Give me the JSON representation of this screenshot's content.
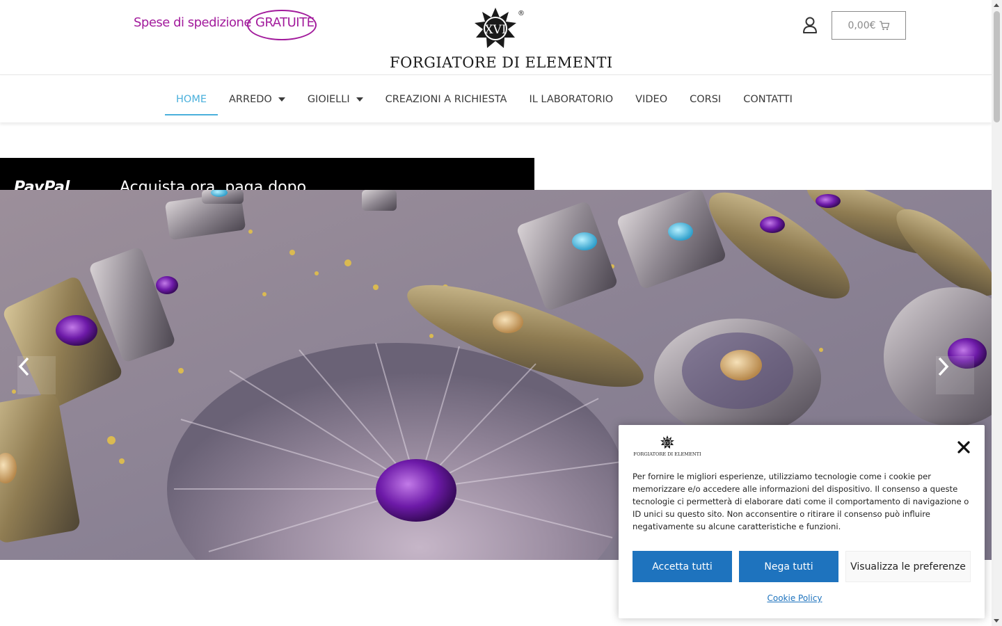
{
  "header": {
    "shipping_text": "Spese di spedizione",
    "shipping_free": "GRATUITE",
    "logo_badge": "XVI",
    "logo_registered": "®",
    "logo_brand": "FORGIATORE DI ELEMENTI",
    "user_icon": "user-icon",
    "cart_total": "0,00€",
    "cart_icon": "cart-icon"
  },
  "nav": {
    "items": [
      {
        "label": "HOME",
        "active": true
      },
      {
        "label": "ARREDO",
        "dropdown": true
      },
      {
        "label": "GIOIELLI",
        "dropdown": true
      },
      {
        "label": "CREAZIONI A RICHIESTA"
      },
      {
        "label": "IL LABORATORIO"
      },
      {
        "label": "VIDEO"
      },
      {
        "label": "CORSI"
      },
      {
        "label": "CONTATTI"
      }
    ],
    "active_color": "#4ab0dc"
  },
  "paypal_banner": {
    "logo_text": "PayPal",
    "message": "Acquista ora, paga dopo"
  },
  "hero": {
    "prev_icon": "chevron-left-icon",
    "next_icon": "chevron-right-icon"
  },
  "cookie": {
    "logo_badge": "XVI",
    "logo_brand": "FORGIATORE DI ELEMENTI",
    "text": "Per fornire le migliori esperienze, utilizziamo tecnologie come i cookie per memorizzare e/o accedere alle informazioni del dispositivo. Il consenso a queste tecnologie ci permetterà di elaborare dati come il comportamento di navigazione o ID unici su questo sito. Non acconsentire o ritirare il consenso può influire negativamente su alcune caratteristiche e funzioni.",
    "accept_label": "Accetta tutti",
    "deny_label": "Nega tutti",
    "prefs_label": "Visualizza le preferenze",
    "policy_label": "Cookie Policy",
    "primary_color": "#1e73be"
  },
  "colors": {
    "shipping": "#a21b9c"
  }
}
